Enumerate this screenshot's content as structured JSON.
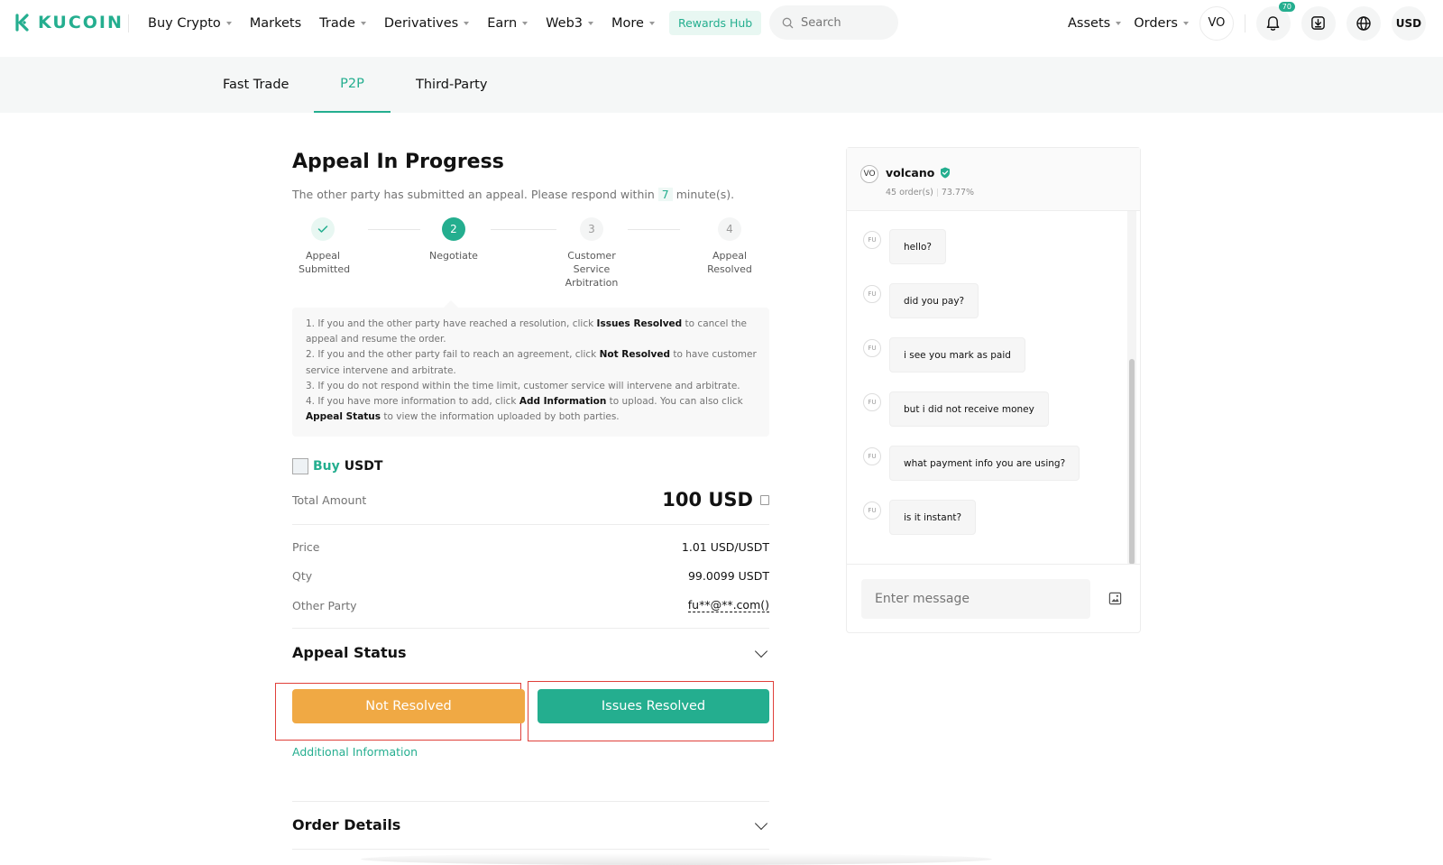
{
  "brand": {
    "name": "KUCOIN",
    "accent": "#24ae8f",
    "warning": "#f0a944"
  },
  "nav": {
    "items": [
      {
        "label": "Buy Crypto",
        "dropdown": true
      },
      {
        "label": "Markets",
        "dropdown": false
      },
      {
        "label": "Trade",
        "dropdown": true
      },
      {
        "label": "Derivatives",
        "dropdown": true
      },
      {
        "label": "Earn",
        "dropdown": true
      },
      {
        "label": "Web3",
        "dropdown": true
      },
      {
        "label": "More",
        "dropdown": true
      }
    ],
    "rewards_label": "Rewards Hub",
    "search_placeholder": "Search",
    "assets_label": "Assets",
    "orders_label": "Orders",
    "avatar_initials": "VO",
    "notification_count": "70",
    "currency_label": "USD"
  },
  "subnav": {
    "tabs": [
      "Fast Trade",
      "P2P",
      "Third-Party"
    ],
    "active": "P2P"
  },
  "appeal": {
    "title": "Appeal In Progress",
    "subtitle_before": "The other party has submitted an appeal. Please respond within",
    "minutes": "7",
    "subtitle_after": "minute(s).",
    "steps": [
      {
        "num": "1",
        "label": "Appeal Submitted",
        "state": "done"
      },
      {
        "num": "2",
        "label": "Negotiate",
        "state": "active"
      },
      {
        "num": "3",
        "label": "Customer Service Arbitration",
        "state": "todo"
      },
      {
        "num": "4",
        "label": "Appeal Resolved",
        "state": "todo"
      }
    ],
    "info": {
      "l1a": "1. If you and the other party have reached a resolution, click ",
      "l1b": "Issues Resolved",
      "l1c": " to cancel the appeal and resume the order.",
      "l2a": "2. If you and the other party fail to reach an agreement, click ",
      "l2b": "Not Resolved",
      "l2c": " to have customer service intervene and arbitrate.",
      "l3": "3. If you do not respond within the time limit, customer service will intervene and arbitrate.",
      "l4a": "4. If you have more information to add, click ",
      "l4b": "Add Information",
      "l4c": " to upload. You can also click ",
      "l4d": "Appeal Status",
      "l4e": " to view the information uploaded by both parties."
    }
  },
  "order": {
    "side": "Buy",
    "asset": "USDT",
    "total_label": "Total Amount",
    "total_value": "100 USD",
    "price_label": "Price",
    "price_value": "1.01 USD/USDT",
    "qty_label": "Qty",
    "qty_value": "99.0099 USDT",
    "party_label": "Other Party",
    "party_value": "fu**@**.com()"
  },
  "sections": {
    "appeal_status": "Appeal Status",
    "order_details": "Order Details"
  },
  "actions": {
    "not_resolved": "Not Resolved",
    "issues_resolved": "Issues Resolved",
    "additional_info": "Additional Information"
  },
  "chat": {
    "avatar": "VO",
    "name": "volcano",
    "orders": "45 order(s)",
    "rate": "73.77%",
    "sender_initials": "FU",
    "messages": [
      "hello?",
      "did you pay?",
      "i see you mark as paid",
      "but i did not receive money",
      "what payment info you are using?",
      "is it instant?"
    ],
    "input_placeholder": "Enter message"
  }
}
